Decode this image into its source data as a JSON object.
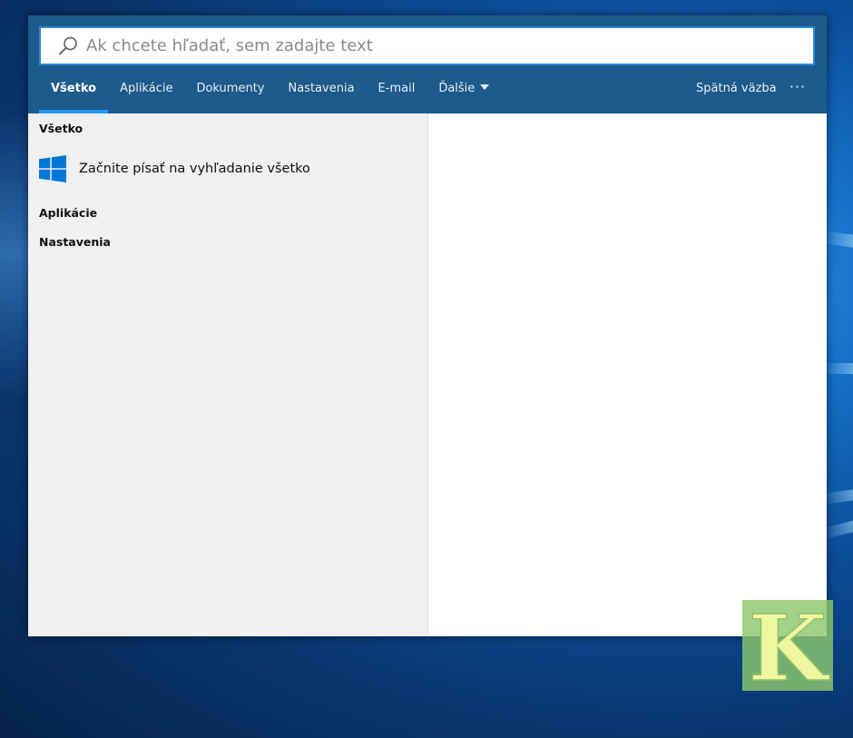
{
  "search": {
    "placeholder": "Ak chcete hľadať, sem zadajte text",
    "value": ""
  },
  "tabs": [
    {
      "label": "Všetko",
      "active": true
    },
    {
      "label": "Aplikácie",
      "active": false
    },
    {
      "label": "Dokumenty",
      "active": false
    },
    {
      "label": "Nastavenia",
      "active": false
    },
    {
      "label": "E-mail",
      "active": false
    },
    {
      "label": "Ďalšie",
      "active": false,
      "has_dropdown": true
    }
  ],
  "toolbar": {
    "feedback_label": "Spätná väzba",
    "more_label": "···"
  },
  "left_pane": {
    "sections": {
      "all_title": "Všetko",
      "hint_text": "Začnite písať na vyhľadanie všetko",
      "hint_icon": "windows-logo-icon",
      "apps_title": "Aplikácie",
      "settings_title": "Nastavenia"
    }
  },
  "colors": {
    "header_bg": "#1e5a8c",
    "accent": "#2196f3",
    "left_pane_bg": "#f0f0f0",
    "windows_logo": "#0078d7"
  },
  "watermark": {
    "letter": "K"
  }
}
